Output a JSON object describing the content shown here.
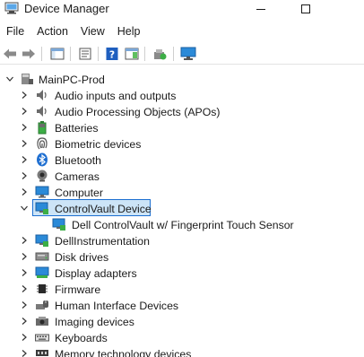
{
  "window": {
    "title": "Device Manager"
  },
  "menu": {
    "items": [
      "File",
      "Action",
      "View",
      "Help"
    ]
  },
  "tree": {
    "root": "MainPC-Prod",
    "categories": [
      {
        "label": "Audio inputs and outputs",
        "icon": "speaker-icon"
      },
      {
        "label": "Audio Processing Objects (APOs)",
        "icon": "speaker-icon"
      },
      {
        "label": "Batteries",
        "icon": "battery-icon"
      },
      {
        "label": "Biometric devices",
        "icon": "fingerprint-icon"
      },
      {
        "label": "Bluetooth",
        "icon": "bluetooth-icon"
      },
      {
        "label": "Cameras",
        "icon": "camera-icon"
      },
      {
        "label": "Computer",
        "icon": "monitor-icon"
      },
      {
        "label": "ControlVault Device",
        "icon": "network-monitor-icon",
        "expanded": true,
        "selected": true
      },
      {
        "label": "Dell ControlVault w/ Fingerprint Touch Sensor",
        "icon": "network-monitor-icon",
        "child": true
      },
      {
        "label": "DellInstrumentation",
        "icon": "network-monitor-icon"
      },
      {
        "label": "Disk drives",
        "icon": "disk-drive-icon"
      },
      {
        "label": "Display adapters",
        "icon": "display-adapter-icon"
      },
      {
        "label": "Firmware",
        "icon": "chip-icon"
      },
      {
        "label": "Human Interface Devices",
        "icon": "hid-icon"
      },
      {
        "label": "Imaging devices",
        "icon": "camera-icon"
      },
      {
        "label": "Keyboards",
        "icon": "keyboard-icon"
      },
      {
        "label": "Memory technology devices",
        "icon": "memory-icon"
      }
    ]
  },
  "colors": {
    "selection_fill": "#cce4f7",
    "selection_border": "#1c6fd1",
    "toolbar_blue": "#1f5fbf",
    "monitor_blue": "#2b8ad8",
    "network_green": "#3cae46"
  }
}
